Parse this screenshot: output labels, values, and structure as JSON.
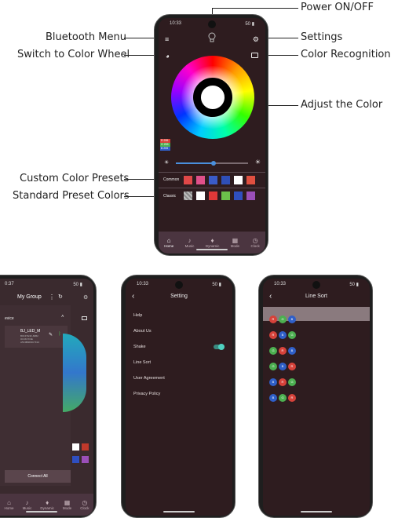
{
  "annotations": {
    "power": "Power ON/OFF",
    "bluetooth": "Bluetooth Menu",
    "settings": "Settings",
    "switch_wheel": "Switch to Color Wheel",
    "color_recognition": "Color Recognition",
    "adjust": "Adjust the Color",
    "custom_presets": "Custom Color Presets",
    "standard_presets": "Standard Preset Colors"
  },
  "main_phone": {
    "time": "10:33",
    "signal": "50",
    "rgb": {
      "r": "R 255",
      "g": "G 255",
      "b": "B 255"
    },
    "common_label": "Common",
    "classic_label": "Classic",
    "common_colors": [
      "#e04848",
      "#e0508a",
      "#3a5bc8",
      "#2f4fb8",
      "#ffffff",
      "#e05040"
    ],
    "classic_colors": [
      "#ffffff",
      "#e03838",
      "#6cc04a",
      "#2f4fc0",
      "#9a4fb8"
    ],
    "brightness": 0.52,
    "tabs": [
      {
        "label": "Home",
        "icon": "home-icon",
        "glyph": "⌂"
      },
      {
        "label": "Music",
        "icon": "music-icon",
        "glyph": "♪"
      },
      {
        "label": "Dynamic",
        "icon": "mic-icon",
        "glyph": "♦"
      },
      {
        "label": "Mode",
        "icon": "grid-icon",
        "glyph": "▦"
      },
      {
        "label": "Clock",
        "icon": "clock-icon",
        "glyph": "◷"
      }
    ]
  },
  "group_phone": {
    "time": "0:37",
    "title": "My Group",
    "section": "evice",
    "device_name": "BJ_LED_M",
    "device_info_1": "B0CF7E3F-60B2",
    "device_info_2": "0CC8-7F3E",
    "device_info_3": "A5C0B2D9C7F24",
    "connect_all": "Connect All",
    "tabs": [
      "Home",
      "Music",
      "Dynamic",
      "Mode",
      "Clock"
    ]
  },
  "setting_phone": {
    "time": "10:33",
    "title": "Setting",
    "items": [
      "Help",
      "About Us",
      "Shake",
      "Line Sort",
      "User Agreement",
      "Privacy Policy"
    ]
  },
  "linesort_phone": {
    "time": "10:33",
    "title": "Line Sort",
    "rows": [
      [
        "R",
        "G",
        "B"
      ],
      [
        "R",
        "B",
        "G"
      ],
      [
        "G",
        "R",
        "B"
      ],
      [
        "G",
        "B",
        "R"
      ],
      [
        "B",
        "R",
        "G"
      ],
      [
        "B",
        "G",
        "R"
      ]
    ]
  },
  "colors": {
    "r": "#d6423a",
    "g": "#4caf50",
    "b": "#2f5fc8",
    "accent": "#4a8fdc"
  }
}
